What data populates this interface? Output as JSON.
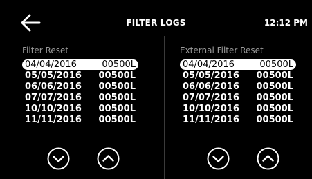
{
  "header": {
    "title": "FILTER LOGS",
    "time": "12:12 PM",
    "back_icon": "arrow-left-icon"
  },
  "panels": {
    "filter_reset": {
      "title": "Filter Reset",
      "rows": [
        {
          "date": "04/04/2016",
          "volume": "00500L",
          "selected": true
        },
        {
          "date": "05/05/2016",
          "volume": "00500L",
          "selected": false
        },
        {
          "date": "06/06/2016",
          "volume": "00500L",
          "selected": false
        },
        {
          "date": "07/07/2016",
          "volume": "00500L",
          "selected": false
        },
        {
          "date": "10/10/2016",
          "volume": "00500L",
          "selected": false
        },
        {
          "date": "11/11/2016",
          "volume": "00500L",
          "selected": false
        }
      ]
    },
    "external_filter_reset": {
      "title": "External Filter Reset",
      "rows": [
        {
          "date": "04/04/2016",
          "volume": "00500L",
          "selected": true
        },
        {
          "date": "05/05/2016",
          "volume": "00500L",
          "selected": false
        },
        {
          "date": "06/06/2016",
          "volume": "00500L",
          "selected": false
        },
        {
          "date": "07/07/2016",
          "volume": "00500L",
          "selected": false
        },
        {
          "date": "10/10/2016",
          "volume": "00500L",
          "selected": false
        },
        {
          "date": "11/11/2016",
          "volume": "00500L",
          "selected": false
        }
      ]
    }
  },
  "controls": {
    "scroll_down_icon": "chevron-down-circle-icon",
    "scroll_up_icon": "chevron-up-circle-icon"
  },
  "colors": {
    "background": "#000000",
    "foreground": "#ffffff",
    "muted": "#9a9a9a",
    "divider": "#3a3a3a"
  }
}
